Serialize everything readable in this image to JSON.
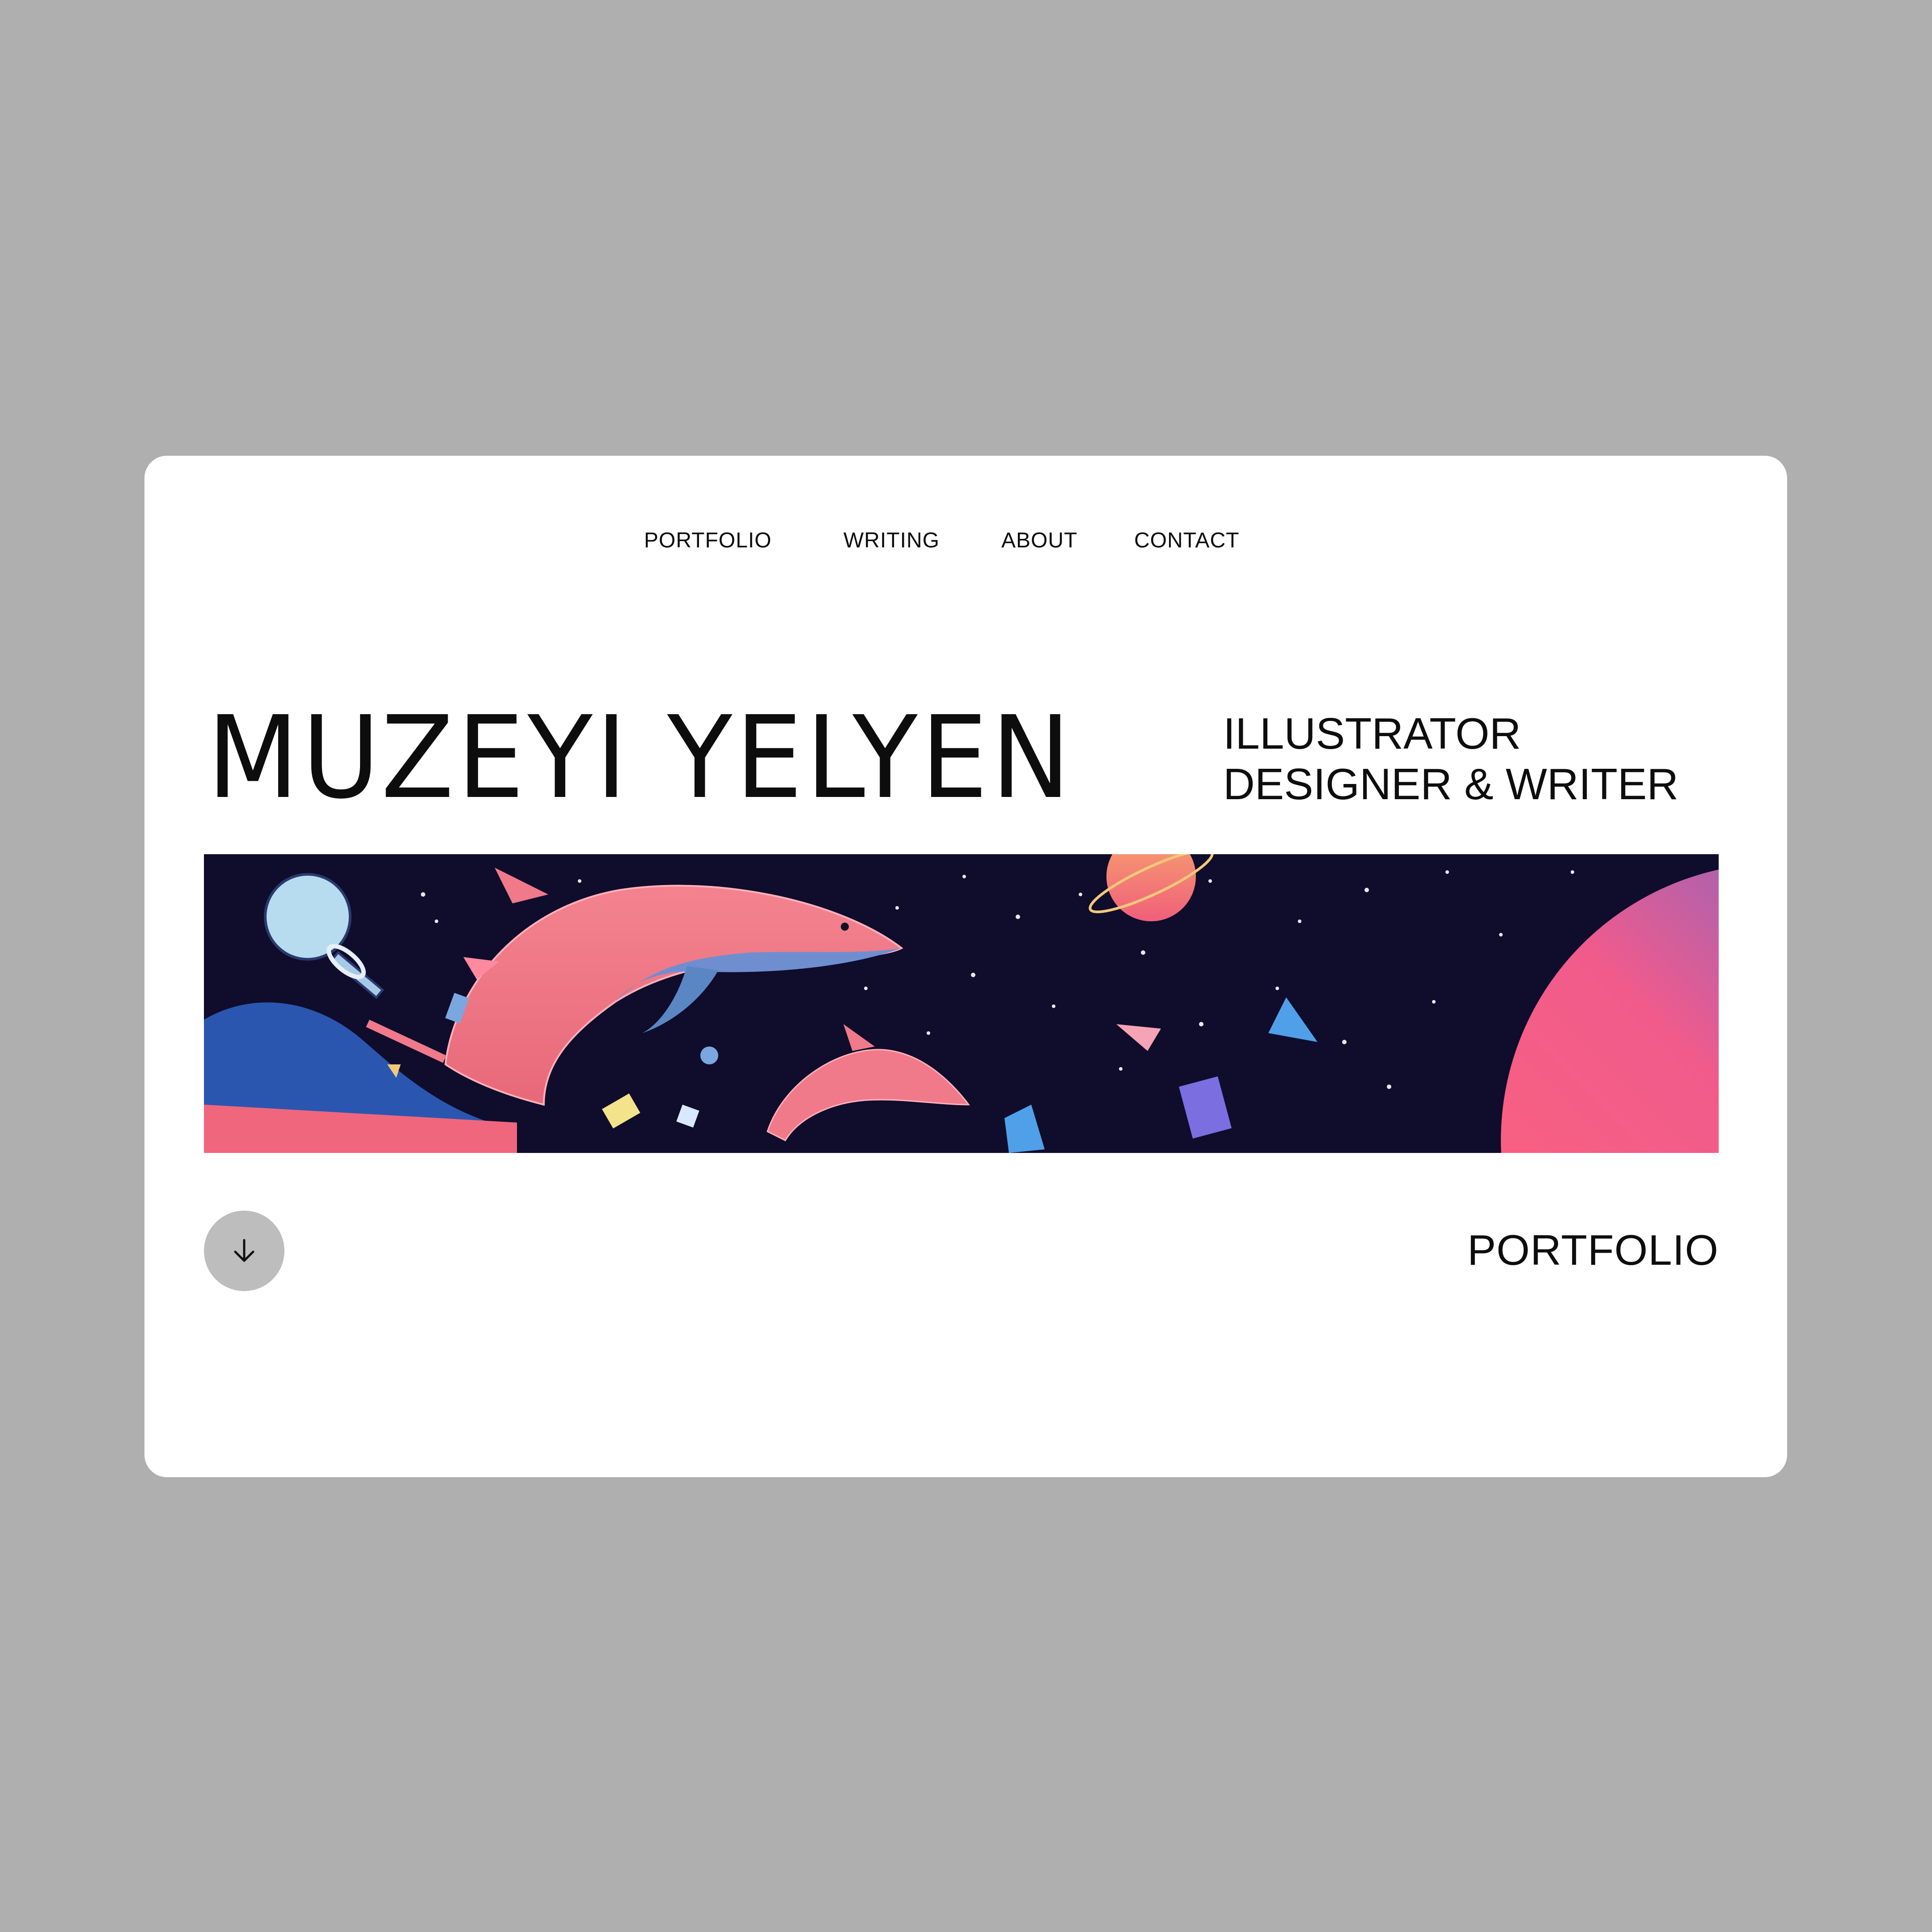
{
  "nav": {
    "items": [
      {
        "label": "PORTFOLIO"
      },
      {
        "label": "WRITING"
      },
      {
        "label": "ABOUT"
      },
      {
        "label": "CONTACT"
      }
    ]
  },
  "hero": {
    "name": "MUZEYI YELYEN",
    "tagline_line1": "ILLUSTRATOR",
    "tagline_line2": "DESIGNER & WRITER",
    "banner_alt": ""
  },
  "footer_row": {
    "scroll_icon": "arrow-down-icon",
    "section_label": "PORTFOLIO"
  },
  "colors": {
    "page_bg": "#afafaf",
    "card_bg": "#ffffff",
    "text": "#0d0d0d",
    "button_bg": "#bdbdbd",
    "banner_sky": "#0f0c2c",
    "dolphin_pink": "#f07a8a",
    "dolphin_blue": "#5b86c4",
    "planet_gradient_start": "#ff6b7a",
    "planet_gradient_end": "#4f6fe0"
  }
}
